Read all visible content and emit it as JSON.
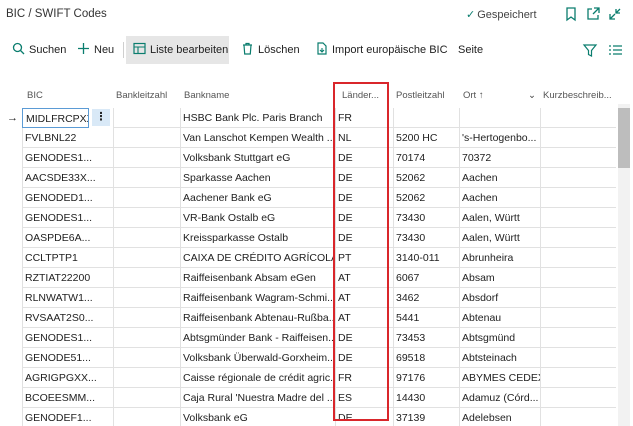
{
  "header": {
    "title": "BIC / SWIFT Codes",
    "saved_label": "Gespeichert"
  },
  "toolbar": {
    "search": "Suchen",
    "new": "Neu",
    "edit_list": "Liste bearbeiten",
    "delete": "Löschen",
    "import": "Import europäische BIC",
    "page": "Seite"
  },
  "columns": {
    "bic": "BIC",
    "bankcode": "Bankleitzahl",
    "bankname": "Bankname",
    "country": "Länder...",
    "postcode": "Postleitzahl",
    "city": "Ort",
    "desc": "Kurzbeschreib..."
  },
  "rows": [
    {
      "bic": "MIDLFRCPXXC",
      "bankname": "HSBC Bank Plc. Paris Branch",
      "country": "FR",
      "postcode": "",
      "city": ""
    },
    {
      "bic": "FVLBNL22",
      "bankname": "Van Lanschot Kempen Wealth ...",
      "country": "NL",
      "postcode": "5200 HC",
      "city": "'s-Hertogenbo..."
    },
    {
      "bic": "GENODES1...",
      "bankname": "Volksbank Stuttgart eG",
      "country": "DE",
      "postcode": "70174",
      "city": "70372"
    },
    {
      "bic": "AACSDE33X...",
      "bankname": "Sparkasse Aachen",
      "country": "DE",
      "postcode": "52062",
      "city": "Aachen"
    },
    {
      "bic": "GENODED1...",
      "bankname": "Aachener Bank eG",
      "country": "DE",
      "postcode": "52062",
      "city": "Aachen"
    },
    {
      "bic": "GENODES1...",
      "bankname": "VR-Bank Ostalb eG",
      "country": "DE",
      "postcode": "73430",
      "city": "Aalen, Württ"
    },
    {
      "bic": "OASPDE6A...",
      "bankname": "Kreissparkasse Ostalb",
      "country": "DE",
      "postcode": "73430",
      "city": "Aalen, Württ"
    },
    {
      "bic": "CCLTPTP1",
      "bankname": "CAIXA DE CRÉDITO AGRÍCOLA ...",
      "country": "PT",
      "postcode": "3140-011",
      "city": "Abrunheira"
    },
    {
      "bic": "RZTIAT22200",
      "bankname": "Raiffeisenbank Absam eGen",
      "country": "AT",
      "postcode": "6067",
      "city": "Absam"
    },
    {
      "bic": "RLNWATW1...",
      "bankname": "Raiffeisenbank Wagram-Schmi...",
      "country": "AT",
      "postcode": "3462",
      "city": "Absdorf"
    },
    {
      "bic": "RVSAAT2S0...",
      "bankname": "Raiffeisenbank Abtenau-Rußba...",
      "country": "AT",
      "postcode": "5441",
      "city": "Abtenau"
    },
    {
      "bic": "GENODES1...",
      "bankname": "Abtsgmünder Bank - Raiffeisen...",
      "country": "DE",
      "postcode": "73453",
      "city": "Abtsgmünd"
    },
    {
      "bic": "GENODE51...",
      "bankname": "Volksbank Überwald-Gorxheim...",
      "country": "DE",
      "postcode": "69518",
      "city": "Abtsteinach"
    },
    {
      "bic": "AGRIGPGXX...",
      "bankname": "Caisse régionale de crédit agric...",
      "country": "FR",
      "postcode": "97176",
      "city": "ABYMES CEDEX"
    },
    {
      "bic": "BCOEESMM...",
      "bankname": "Caja Rural 'Nuestra Madre del ...",
      "country": "ES",
      "postcode": "14430",
      "city": "Adamuz (Córd..."
    },
    {
      "bic": "GENODEF1...",
      "bankname": "Volksbank eG",
      "country": "DE",
      "postcode": "37139",
      "city": "Adelebsen"
    }
  ]
}
